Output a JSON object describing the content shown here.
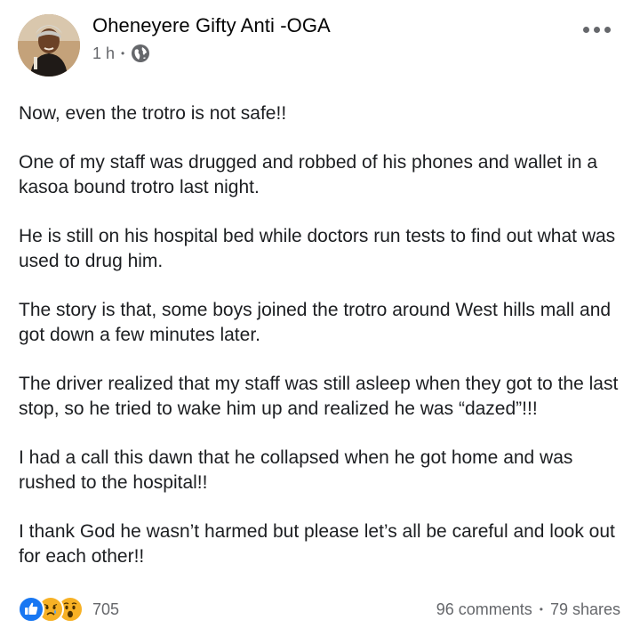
{
  "post": {
    "author": "Oheneyere Gifty Anti -OGA",
    "time": "1 h",
    "separator": "•",
    "privacy_icon": "globe-icon",
    "paragraphs": [
      "Now, even the trotro is not safe!!",
      "One of my staff was drugged and robbed of his phones and wallet in a kasoa bound trotro last night.",
      "He is still on his hospital bed while doctors run tests to find out what was used to drug him.",
      "The story is that, some boys joined the trotro around West hills mall and got down a few minutes later.",
      "The driver realized that my staff was still asleep when they got to the last stop, so he tried to wake him up and realized he was “dazed”!!!",
      "I had a call this dawn that he collapsed when he got home and was rushed to the hospital!!",
      "I thank God he wasn’t harmed but please let’s all be careful and look out for each other!!"
    ]
  },
  "footer": {
    "reaction_icons": [
      "like-icon",
      "sad-icon",
      "wow-icon"
    ],
    "reaction_count": "705",
    "comments": "96 comments",
    "separator": "•",
    "shares": "79 shares"
  },
  "colors": {
    "text": "#1c1e21",
    "secondary": "#65676b",
    "like_blue": "#1877f2",
    "emoji_yellow": "#f7b125"
  }
}
